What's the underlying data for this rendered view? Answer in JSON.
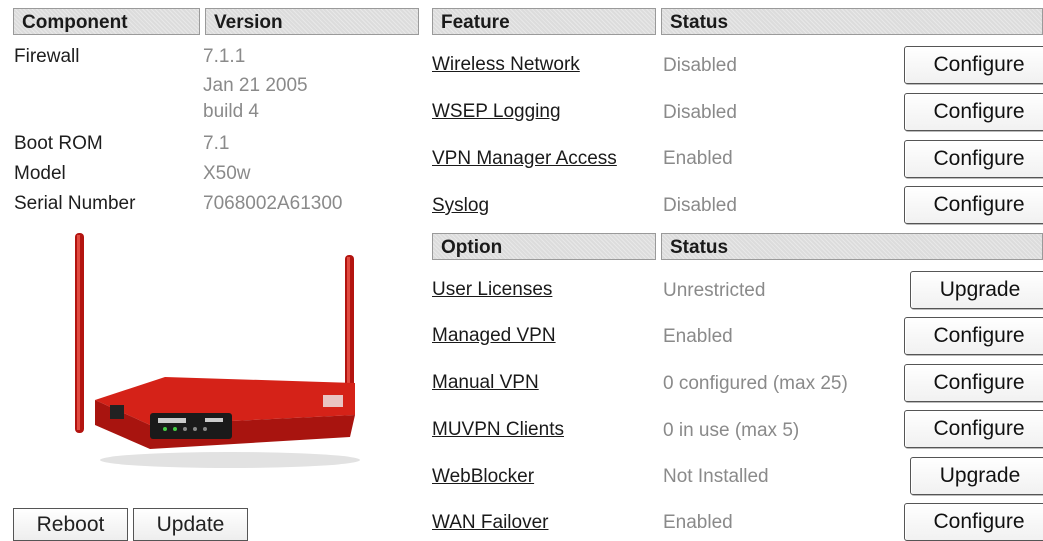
{
  "left_table": {
    "header": {
      "component": "Component",
      "version": "Version"
    },
    "rows": [
      {
        "label": "Firewall",
        "values": [
          "7.1.1",
          "Jan 21 2005",
          "build 4"
        ]
      },
      {
        "label": "Boot ROM",
        "values": [
          "7.1"
        ]
      },
      {
        "label": "Model",
        "values": [
          "X50w"
        ]
      },
      {
        "label": "Serial Number",
        "values": [
          "7068002A61300"
        ]
      }
    ]
  },
  "device_image": {
    "name": "red-router-with-antennas",
    "color": "#cc1b14"
  },
  "bottom_buttons": {
    "reboot": "Reboot",
    "update": "Update"
  },
  "features": {
    "header": {
      "feature": "Feature",
      "status": "Status"
    },
    "rows": [
      {
        "name": "Wireless Network",
        "status": "Disabled",
        "action": "Configure"
      },
      {
        "name": "WSEP Logging",
        "status": "Disabled",
        "action": "Configure"
      },
      {
        "name": "VPN Manager Access",
        "status": "Enabled",
        "action": "Configure"
      },
      {
        "name": "Syslog",
        "status": "Disabled",
        "action": "Configure"
      }
    ]
  },
  "options": {
    "header": {
      "option": "Option",
      "status": "Status"
    },
    "rows": [
      {
        "name": "User Licenses",
        "status": "Unrestricted",
        "action": "Upgrade"
      },
      {
        "name": "Managed VPN",
        "status": "Enabled",
        "action": "Configure"
      },
      {
        "name": "Manual VPN",
        "status": "0 configured (max 25)",
        "action": "Configure"
      },
      {
        "name": "MUVPN Clients",
        "status": "0 in use (max 5)",
        "action": "Configure"
      },
      {
        "name": "WebBlocker",
        "status": "Not Installed",
        "action": "Upgrade"
      },
      {
        "name": "WAN Failover",
        "status": "Enabled",
        "action": "Configure"
      }
    ]
  }
}
